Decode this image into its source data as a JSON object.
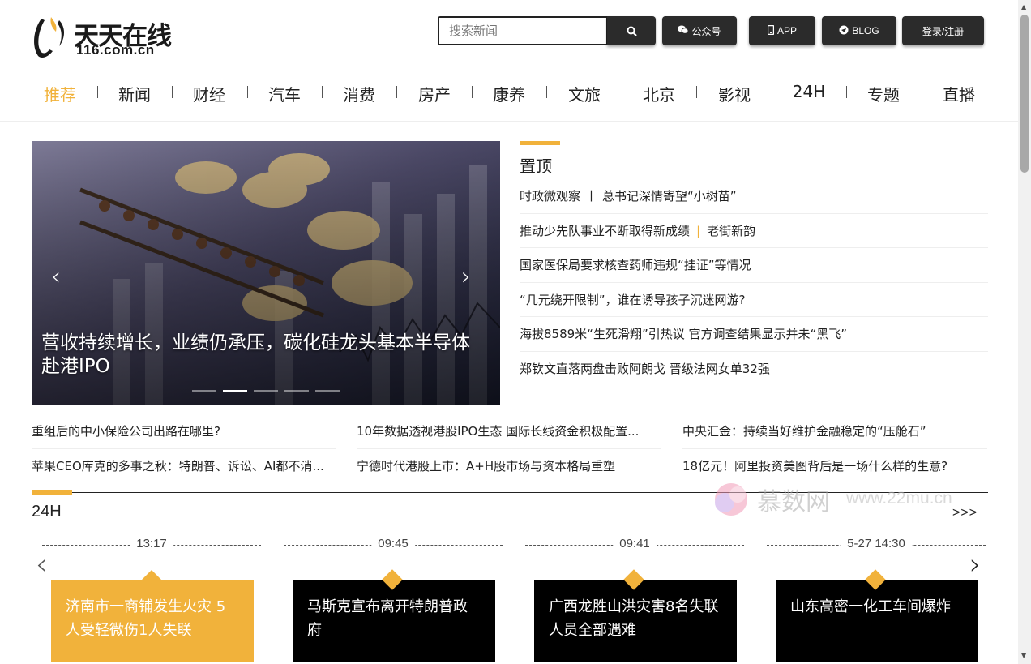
{
  "header": {
    "logo_cn": "天天在线",
    "logo_en": "116.com.cn",
    "search_placeholder": "搜索新闻",
    "buttons": [
      {
        "label": "公众号",
        "icon": "wechat-icon"
      },
      {
        "label": "APP",
        "icon": "mobile-icon"
      },
      {
        "label": "BLOG",
        "icon": "blog-icon"
      },
      {
        "label": "登录/注册"
      }
    ]
  },
  "nav": [
    "推荐",
    "新闻",
    "财经",
    "汽车",
    "消费",
    "房产",
    "康养",
    "文旅",
    "北京",
    "影视",
    "24H",
    "专题",
    "直播"
  ],
  "carousel": {
    "title": "营收持续增长，业绩仍承压，碳化硅龙头基本半导体赴港IPO",
    "slide_count": 5,
    "active_slide": 2
  },
  "pinned": {
    "title": "置顶",
    "items": [
      {
        "a": "时政微观察",
        "sep": "丨",
        "b": "总书记深情寄望“小树苗”",
        "sep_color": "dark"
      },
      {
        "a": "推动少先队事业不断取得新成绩",
        "sep": "|",
        "b": "老街新韵",
        "sep_color": "yellow"
      },
      {
        "a": "国家医保局要求核查药师违规“挂证”等情况"
      },
      {
        "a": "“几元绕开限制”，谁在诱导孩子沉迷网游?"
      },
      {
        "a": "海拔8589米“生死滑翔”引热议 官方调查结果显示并未“黑飞”"
      },
      {
        "a": "郑钦文直落两盘击败阿朗戈 晋级法网女单32强"
      }
    ]
  },
  "grid_news": [
    "重组后的中小保险公司出路在哪里?",
    "10年数据透视港股IPO生态 国际长线资金积极配置...",
    "中央汇金：持续当好维护金融稳定的“压舱石”",
    "苹果CEO库克的多事之秋：特朗普、诉讼、AI都不消...",
    "宁德时代港股上市：A+H股市场与资本格局重塑",
    "18亿元！阿里投资美图背后是一场什么样的生意?"
  ],
  "h24": {
    "title": "24H",
    "more": ">>>",
    "items": [
      {
        "time": "13:17",
        "text": "济南市一商铺发生火灾 5人受轻微伤1人失联",
        "highlight": true
      },
      {
        "time": "09:45",
        "text": "马斯克宣布离开特朗普政府",
        "highlight": false
      },
      {
        "time": "09:41",
        "text": "广西龙胜山洪灾害8名失联人员全部遇难",
        "highlight": false
      },
      {
        "time": "5-27 14:30",
        "text": "山东高密一化工车间爆炸",
        "highlight": false
      }
    ]
  },
  "watermark": {
    "cn": "慕数网",
    "url": "www.22mu.cn"
  },
  "colors": {
    "accent": "#f1b23b",
    "dark": "#2b2b2b",
    "black": "#000000"
  }
}
